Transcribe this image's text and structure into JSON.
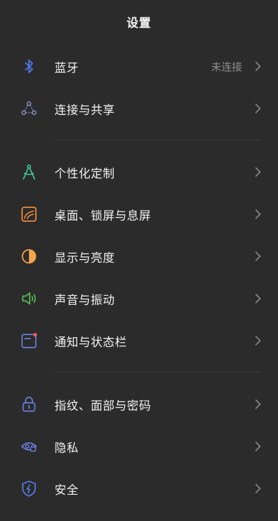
{
  "header": {
    "title": "设置"
  },
  "icons": {
    "bluetooth": "bluetooth-icon",
    "connection": "connection-share-icon",
    "customize": "compass-icon",
    "desktop": "wallpaper-icon",
    "display": "brightness-icon",
    "sound": "speaker-icon",
    "notification": "notification-icon",
    "fingerprint": "lock-icon",
    "privacy": "privacy-eye-icon",
    "security": "shield-icon"
  },
  "colors": {
    "background": "#2b2b2b",
    "bluetooth": "#4f7bf0",
    "connection": "#8a94c8",
    "customize": "#3ec99a",
    "desktop": "#f08a3a",
    "display": "#f5a54a",
    "sound": "#5ac05a",
    "notification": "#6a80e0",
    "notification_dot": "#ff5a5a",
    "fingerprint": "#6a80e0",
    "privacy": "#6a80e0",
    "security": "#5a7ef0"
  },
  "groups": [
    {
      "items": [
        {
          "label": "蓝牙",
          "value": "未连接"
        },
        {
          "label": "连接与共享"
        }
      ]
    },
    {
      "items": [
        {
          "label": "个性化定制"
        },
        {
          "label": "桌面、锁屏与息屏"
        },
        {
          "label": "显示与亮度"
        },
        {
          "label": "声音与振动"
        },
        {
          "label": "通知与状态栏"
        }
      ]
    },
    {
      "items": [
        {
          "label": "指纹、面部与密码"
        },
        {
          "label": "隐私"
        },
        {
          "label": "安全"
        }
      ]
    }
  ]
}
